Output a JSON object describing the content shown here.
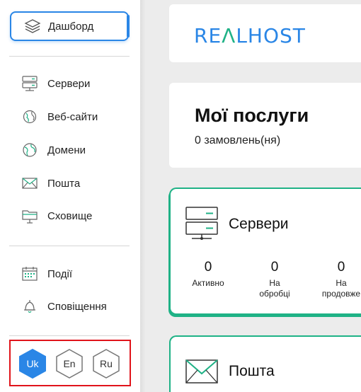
{
  "sidebar": {
    "dashboard_label": "Дашборд",
    "items": [
      {
        "label": "Сервери",
        "icon": "server-icon"
      },
      {
        "label": "Веб-сайти",
        "icon": "globe-icon"
      },
      {
        "label": "Домени",
        "icon": "domain-globe-icon"
      },
      {
        "label": "Пошта",
        "icon": "mail-icon"
      },
      {
        "label": "Сховище",
        "icon": "storage-folder-icon"
      }
    ],
    "secondary_items": [
      {
        "label": "Події",
        "icon": "calendar-icon"
      },
      {
        "label": "Сповіщення",
        "icon": "bell-icon"
      }
    ],
    "languages": [
      {
        "code": "Uk",
        "active": true
      },
      {
        "code": "En",
        "active": false
      },
      {
        "code": "Ru",
        "active": false
      }
    ]
  },
  "header": {
    "logo_text_blue": "RE",
    "logo_text_accent": "Λ",
    "logo_text_rest": "LHOST"
  },
  "services": {
    "title": "Мої послуги",
    "subtitle": "0 замовлень(ня)"
  },
  "cards": {
    "servers": {
      "name": "Сервери",
      "stats": [
        {
          "value": "0",
          "caption_line1": "Активно",
          "caption_line2": ""
        },
        {
          "value": "0",
          "caption_line1": "На",
          "caption_line2": "обробці"
        },
        {
          "value": "0",
          "caption_line1": "На",
          "caption_line2": "продовже"
        }
      ]
    },
    "mail": {
      "name": "Пошта"
    }
  },
  "colors": {
    "accent_blue": "#2a86e6",
    "accent_green": "#1fb286",
    "highlight_red": "#e0141b"
  }
}
